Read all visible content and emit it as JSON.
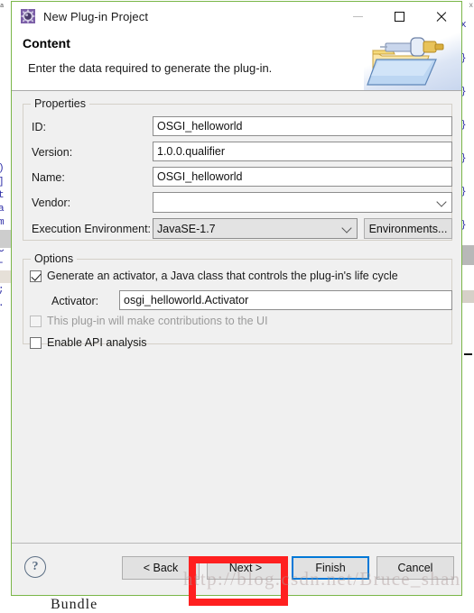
{
  "window": {
    "title": "New Plug-in Project",
    "icon": "plugin-gear-icon",
    "controls": {
      "minimize": "–",
      "maximize": "□",
      "close": "✕"
    },
    "accent_border": "#7ab648"
  },
  "header": {
    "title": "Content",
    "subtitle": "Enter the data required to generate the plug-in.",
    "banner_icon": "folder-plug-icon"
  },
  "properties": {
    "legend": "Properties",
    "fields": [
      {
        "label": "ID:",
        "value": "OSGI_helloworld",
        "type": "text"
      },
      {
        "label": "Version:",
        "value": "1.0.0.qualifier",
        "type": "text"
      },
      {
        "label": "Name:",
        "value": "OSGI_helloworld",
        "type": "text"
      },
      {
        "label": "Vendor:",
        "value": "",
        "type": "combo"
      }
    ],
    "execution_environment": {
      "label": "Execution Environment:",
      "value": "JavaSE-1.7",
      "button": "Environments..."
    }
  },
  "options": {
    "legend": "Options",
    "generate_activator": {
      "label": "Generate an activator, a Java class that controls the plug-in's life cycle",
      "checked": true
    },
    "activator": {
      "label": "Activator:",
      "value": "osgi_helloworld.Activator"
    },
    "ui_contributions": {
      "label": "This plug-in will make contributions to the UI",
      "checked": false,
      "disabled": true
    },
    "api_analysis": {
      "label": "Enable API analysis",
      "checked": false
    }
  },
  "footer": {
    "help": "?",
    "buttons": [
      {
        "label": "< Back",
        "focused": false
      },
      {
        "label": "Next >",
        "focused": false,
        "highlighted": true
      },
      {
        "label": "Finish",
        "focused": true
      },
      {
        "label": "Cancel",
        "focused": false
      }
    ],
    "highlight_color": "#ff2020",
    "focus_color": "#0078d7"
  },
  "background": {
    "watermark": "http://blog.csdn.net/Bruce_shan",
    "bottom_word": "Bundle",
    "left_code": ")\n]\nt\na\nm\ns\nC\n-\n]\n;\n.",
    "right_code": "x\n}\n}\n}\n}\n}\n}\n}",
    "left_label": "a",
    "right_label": "x"
  }
}
